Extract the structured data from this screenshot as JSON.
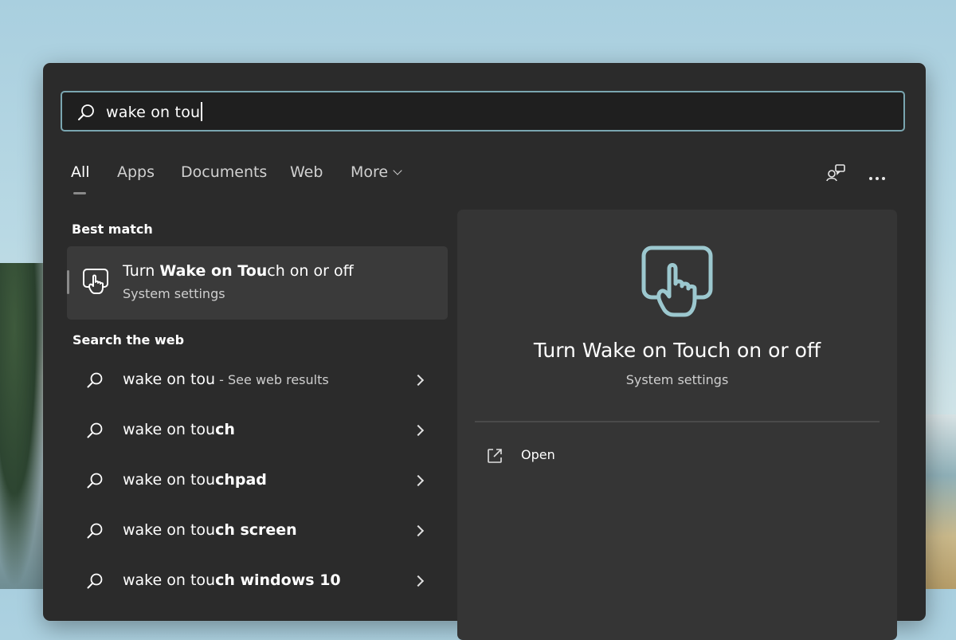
{
  "search": {
    "query": "wake on tou"
  },
  "tabs": [
    {
      "label": "All",
      "active": true
    },
    {
      "label": "Apps"
    },
    {
      "label": "Documents"
    },
    {
      "label": "Web"
    },
    {
      "label": "More"
    }
  ],
  "sections": {
    "best_match_label": "Best match",
    "search_web_label": "Search the web"
  },
  "best_match": {
    "title_prefix": "Turn ",
    "title_bold": "Wake on Tou",
    "title_rest": "ch on or off",
    "subtitle": "System settings",
    "icon": "touch-hand-icon"
  },
  "web_results": [
    {
      "query": "wake on tou",
      "bold": "",
      "suffix": " - See web results"
    },
    {
      "query": "wake on tou",
      "bold": "ch",
      "suffix": ""
    },
    {
      "query": "wake on tou",
      "bold": "chpad",
      "suffix": ""
    },
    {
      "query": "wake on tou",
      "bold": "ch screen",
      "suffix": ""
    },
    {
      "query": "wake on tou",
      "bold": "ch windows 10",
      "suffix": ""
    }
  ],
  "preview": {
    "title": "Turn Wake on Touch on or off",
    "subtitle": "System settings",
    "action_open": "Open",
    "accent_color": "#9cc8cf"
  }
}
